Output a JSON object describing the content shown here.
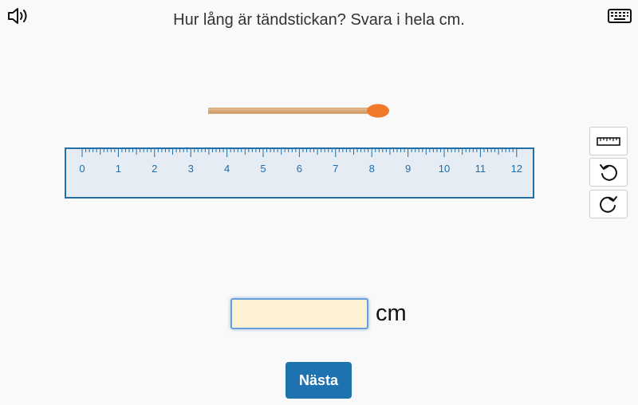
{
  "question": "Hur lång är tändstickan? Svara i hela cm.",
  "icons": {
    "speaker": "speaker-icon",
    "keyboard": "keyboard-icon",
    "ruler_tool": "ruler-icon",
    "undo": "undo-icon",
    "redo": "redo-icon"
  },
  "ruler": {
    "labels": [
      "0",
      "1",
      "2",
      "3",
      "4",
      "5",
      "6",
      "7",
      "8",
      "9",
      "10",
      "11",
      "12"
    ],
    "color": "#1f6fa8",
    "fill": "#e5ecf4"
  },
  "match": {
    "stick_color": "#d9a978",
    "head_color": "#f07a2a"
  },
  "answer": {
    "value": "",
    "unit": "cm"
  },
  "next_button": {
    "label": "Nästa",
    "color": "#1f72b0"
  }
}
